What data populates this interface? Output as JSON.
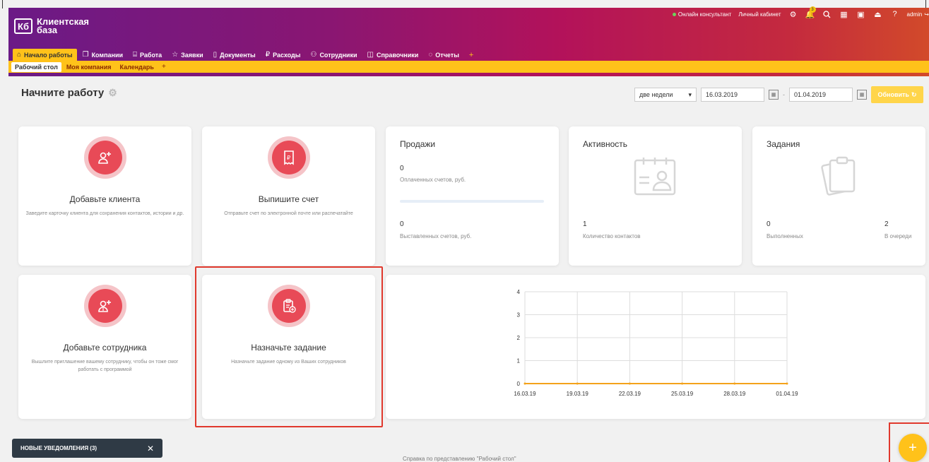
{
  "app": {
    "logo_short": "Кб",
    "logo_name": "Клиентская база"
  },
  "toplinks": {
    "online": "Онлайн консультант",
    "cabinet": "Личный кабинет",
    "notif_count": "3",
    "user": "admin"
  },
  "mainnav": [
    {
      "label": "Начало работы",
      "icon": "home-icon"
    },
    {
      "label": "Компании",
      "icon": "folder-icon"
    },
    {
      "label": "Работа",
      "icon": "briefcase-icon"
    },
    {
      "label": "Заявки",
      "icon": "star-icon"
    },
    {
      "label": "Документы",
      "icon": "document-icon"
    },
    {
      "label": "Расходы",
      "icon": "ruble-icon"
    },
    {
      "label": "Сотрудники",
      "icon": "people-icon"
    },
    {
      "label": "Справочники",
      "icon": "book-icon"
    },
    {
      "label": "Отчеты",
      "icon": "chat-icon"
    }
  ],
  "subnav": [
    "Рабочий стол",
    "Моя компания",
    "Календарь"
  ],
  "page": {
    "title": "Начните работу"
  },
  "filters": {
    "period": "две недели",
    "date_from": "16.03.2019",
    "date_to": "01.04.2019",
    "refresh": "Обновить"
  },
  "cards": {
    "add_client": {
      "title": "Добавьте клиента",
      "desc": "Заведите карточку клиента для сохранения контактов, истории и др."
    },
    "invoice": {
      "title": "Выпишите счет",
      "desc": "Отправьте счет по электронной почте или распечатайте"
    },
    "add_employee": {
      "title": "Добавьте сотрудника",
      "desc": "Вышлите приглашение вашему сотруднику, чтобы он тоже смог работать с программой"
    },
    "task": {
      "title": "Назначьте задание",
      "desc": "Назначьте задание одному из Ваших сотрудников"
    }
  },
  "sales": {
    "title": "Продажи",
    "paid_value": "0",
    "paid_label": "Оплаченных счетов, руб.",
    "paid_fraction": 0,
    "issued_value": "0",
    "issued_label": "Выставленных счетов, руб."
  },
  "activity": {
    "title": "Активность",
    "value": "1",
    "label": "Количество контактов"
  },
  "tasks": {
    "title": "Задания",
    "done_value": "0",
    "done_label": "Выполненных",
    "queue_value": "2",
    "queue_label": "В очереди"
  },
  "chart_data": {
    "type": "line",
    "x": [
      "16.03.19",
      "19.03.19",
      "22.03.19",
      "25.03.19",
      "28.03.19",
      "01.04.19"
    ],
    "y_ticks": [
      0,
      1,
      2,
      3,
      4
    ],
    "ylim": [
      0,
      4
    ],
    "series": [
      {
        "values": [
          0,
          0,
          0,
          0,
          0,
          0
        ],
        "color": "#f4a21a"
      }
    ],
    "grid": true
  },
  "notifications": {
    "label": "НОВЫЕ УВЕДОМЛЕНИЯ (3)"
  },
  "footer": {
    "help": "Справка по представлению \"Рабочий стол\""
  }
}
